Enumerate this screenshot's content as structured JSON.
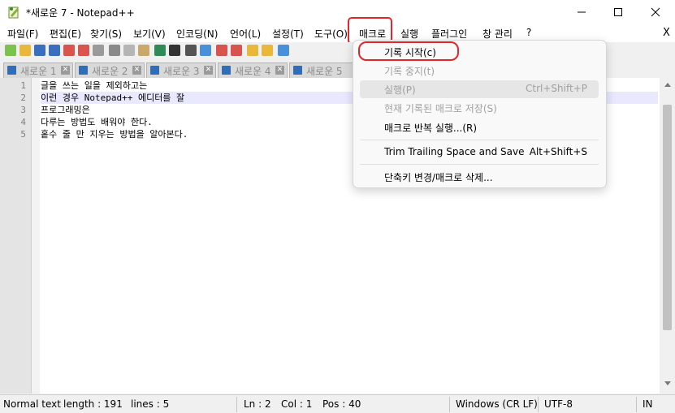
{
  "window": {
    "title": "*새로운 7 - Notepad++"
  },
  "menubar": {
    "items": [
      {
        "label": "파일(F)"
      },
      {
        "label": "편집(E)"
      },
      {
        "label": "찾기(S)"
      },
      {
        "label": "보기(V)"
      },
      {
        "label": "인코딩(N)"
      },
      {
        "label": "언어(L)"
      },
      {
        "label": "설정(T)"
      },
      {
        "label": "도구(O)"
      },
      {
        "label": "매크로"
      },
      {
        "label": "실행"
      },
      {
        "label": "플러그인"
      },
      {
        "label": "창 관리"
      },
      {
        "label": "?"
      }
    ],
    "close_doc": "X"
  },
  "tabs": [
    {
      "label": "새로운 1"
    },
    {
      "label": "새로운 2"
    },
    {
      "label": "새로운 3"
    },
    {
      "label": "새로운 4"
    },
    {
      "label": "새로운 5"
    }
  ],
  "editor": {
    "lines": [
      {
        "num": "1",
        "text": "글을 쓰는 일을 제외하고는"
      },
      {
        "num": "2",
        "text": "이런 경우 Notepad++ 에디터를 잘"
      },
      {
        "num": "3",
        "text": "프로그래밍은"
      },
      {
        "num": "4",
        "text": "다루는 방법도 배워야 한다."
      },
      {
        "num": "5",
        "text": "홑수 줄 만 지우는 방법을 알아본다."
      }
    ]
  },
  "macro_menu": {
    "items": [
      {
        "label": "기록 시작(c)",
        "shortcut": ""
      },
      {
        "label": "기록 중지(t)",
        "shortcut": ""
      },
      {
        "label": "실행(P)",
        "shortcut": "Ctrl+Shift+P"
      },
      {
        "label": "현재 기록된 매크로 저장(S)",
        "shortcut": ""
      },
      {
        "label": "매크로 반복 실행...(R)",
        "shortcut": ""
      },
      {
        "label": "Trim Trailing Space and Save",
        "shortcut": "Alt+Shift+S"
      },
      {
        "label": "단축키 변경/매크로 삭제...",
        "shortcut": ""
      }
    ]
  },
  "statusbar": {
    "type": "Normal text fi",
    "length": "length : 191",
    "lines": "lines : 5",
    "ln": "Ln : 2",
    "col": "Col : 1",
    "pos": "Pos : 40",
    "eol": "Windows (CR LF)",
    "encoding": "UTF-8",
    "mode": "IN"
  },
  "colors": {
    "highlight": "#e0262b",
    "current_line": "#e8e8ff",
    "tab_disk": "#2f6db8"
  }
}
